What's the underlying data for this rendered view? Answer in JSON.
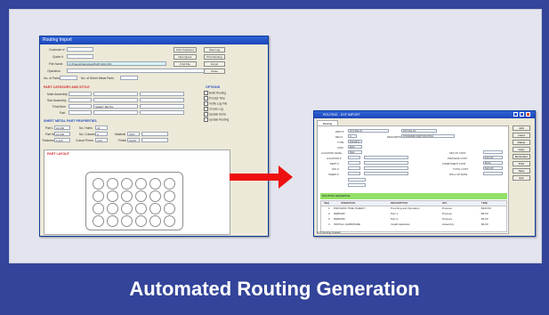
{
  "slide": {
    "title": "Automated Routing Generation",
    "colors": {
      "band": "#33449a",
      "content_bg": "#e3e4ee",
      "arrow": "#ee1010",
      "highlight_green": "#92e067",
      "section_red": "#d2262b",
      "section_blue": "#2a51c6"
    }
  },
  "routing_import_window": {
    "title": "Routing Import",
    "fields": {
      "customer_label": "Customer #",
      "quote_label": "Quote #",
      "file_name_label": "File Name",
      "file_name_value": "C:\\Projects\\Samples\\PART-001.DXF",
      "operation_label": "Operation",
      "no_of_parts_label": "No. of Parts",
      "no_of_sheets_label": "No. of Sheet Metal Parts"
    },
    "buttons": [
      "Find Customer",
      "View Log",
      "New Quote",
      "Print Routing",
      "Find File",
      "Import",
      "Close"
    ],
    "sections": {
      "part_category": "PART CATEGORY AND STYLE",
      "options": "OPTIONS",
      "sheet_metal": "SHEET METAL PART PROPERTIES",
      "part_layout": "PART LAYOUT"
    },
    "category_rows": [
      {
        "label": "Main Assembly",
        "value": ""
      },
      {
        "label": "Sub Assembly",
        "value": ""
      },
      {
        "label": "Final Item",
        "value": "SHEET METAL"
      },
      {
        "label": "Part",
        "value": ""
      }
    ],
    "options": [
      "Build Routing",
      "Prompt Time",
      "Verify Log File",
      "Create Log",
      "Update Items",
      "Update Routing"
    ],
    "sheet_metal": [
      {
        "label": "Part L",
        "value": "20.000"
      },
      {
        "label": "Part W",
        "value": "16.000"
      },
      {
        "label": "Thickness",
        "value": "0.125"
      },
      {
        "label": "No. Holes",
        "value": "24"
      },
      {
        "label": "No. Cutouts",
        "value": "0"
      },
      {
        "label": "Cutout Perim",
        "value": "0.00"
      },
      {
        "label": "Material",
        "value": "CRS"
      },
      {
        "label": "Finish",
        "value": "PAINT"
      }
    ]
  },
  "edit_routing_window": {
    "title": "ROUTING - DXF IMPORT",
    "tab": "Routing",
    "fields": [
      {
        "label": "PART #",
        "value": "DXT-001-23"
      },
      {
        "label": "REV #",
        "value": "A"
      },
      {
        "label": "TYPE",
        "value": "Standard"
      },
      {
        "label": "UOM",
        "value": "Each"
      },
      {
        "label": "LOCATION LEVEL",
        "value": "Main"
      },
      {
        "label": "LOCATION #",
        "value": ""
      },
      {
        "label": "DEPT #",
        "value": ""
      },
      {
        "label": "W/C #",
        "value": ""
      },
      {
        "label": "SHEET #",
        "value": ""
      }
    ],
    "description_label": "DESCRIPTION",
    "description_value": "STANDARD PART ROUTING",
    "part_ref_value": "DXT-001-23",
    "cost_fields": [
      {
        "label": "SET-UP COST",
        "value": ""
      },
      {
        "label": "PROCESS COST",
        "value": "$121.00"
      },
      {
        "label": "COMPONENT COST",
        "value": "$0.00"
      },
      {
        "label": "TOTAL COST",
        "value": "$121.00"
      },
      {
        "label": "ROLL-UP DATE",
        "value": ""
      }
    ],
    "side_buttons": [
      "Add",
      "Insert",
      "Delete",
      "Copy",
      "Renumber",
      "Print",
      "Save",
      "Exit"
    ],
    "section_bar": "ROUTING SEQUENCE",
    "grid_columns": [
      "SEQ",
      "OPERATION",
      "DESCRIPTION",
      "W/C",
      "TIME"
    ],
    "grid_rows": [
      {
        "seq": "1",
        "op": "PROCESS TIME (SHEET)",
        "desc": "Punching and Operation",
        "wc": "Process",
        "time": "$100.00"
      },
      {
        "seq": "2",
        "op": "DEBURR",
        "desc": "Part 1",
        "wc": "Process",
        "time": "$6.00"
      },
      {
        "seq": "3",
        "op": "DEBURR",
        "desc": "Part 2",
        "wc": "Process",
        "time": "$6.00"
      },
      {
        "seq": "4",
        "op": "INSTALL HARDWARE",
        "desc": "Install Hardware",
        "wc": "Assembly",
        "time": "$9.00"
      }
    ],
    "status": "DXF Routing Created"
  }
}
